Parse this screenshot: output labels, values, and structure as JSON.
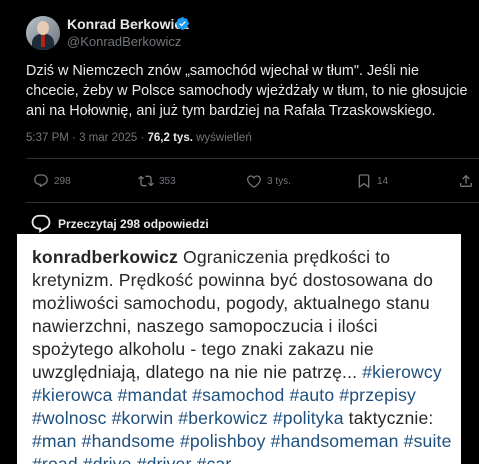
{
  "tweet": {
    "author_name": "Konrad Berkowicz",
    "author_handle": "@KonradBerkowicz",
    "text": "Dziś w Niemczech znów „samochód wjechał w tłum\". Jeśli nie chcecie, żeby w Polsce samochody wjeżdżały w tłum, to nie głosujcie ani na Hołownię, ani już tym bardziej na Rafała Trzaskowskiego.",
    "time": "5:37 PM",
    "separator": "·",
    "date": "3 mar 2025",
    "views_count": "76,2 tys.",
    "views_label": "wyświetleń"
  },
  "actions": {
    "replies": "298",
    "reposts": "353",
    "likes": "3 tys.",
    "bookmarks": "14"
  },
  "read_replies_label": "Przeczytaj 298 odpowiedzi",
  "embedded_post": {
    "username": "konradberkowicz",
    "text_1": " Ograniczenia prędkości to kretynizm. Prędkość powinna być dostosowana do możliwości samochodu, pogody, aktualnego stanu nawierzchni, naszego samopoczucia i ilości spożytego alkoholu - tego znaki zakazu nie uwzględniają, dlatego na nie nie patrzę... ",
    "hashtags_1": "#kierowcy #kierowca #mandat #samochod #auto #przepisy #wolnosc #korwin #berkowicz #polityka",
    "text_2": " taktycznie: ",
    "hashtags_2": "#man #handsome #polishboy #handsomeman #suite #road #drive #driver #car"
  },
  "colors": {
    "background": "#000000",
    "text": "#e7e9ea",
    "muted": "#71767b",
    "verified": "#1d9bf0",
    "hashtag": "#1f4f7c"
  }
}
